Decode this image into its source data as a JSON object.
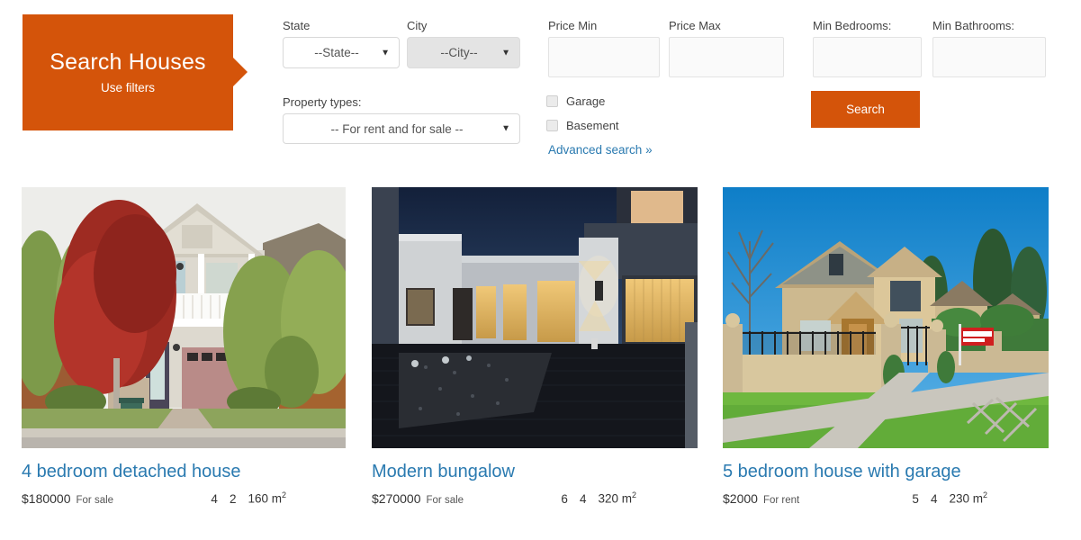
{
  "banner": {
    "title": "Search Houses",
    "subtitle": "Use filters"
  },
  "filters": {
    "state_label": "State",
    "state_value": "--State--",
    "city_label": "City",
    "city_value": "--City--",
    "property_types_label": "Property types:",
    "property_types_value": "-- For rent and for sale --",
    "price_min_label": "Price Min",
    "price_min_value": "",
    "price_max_label": "Price Max",
    "price_max_value": "",
    "min_bedrooms_label": "Min Bedrooms:",
    "min_bedrooms_value": "",
    "min_bathrooms_label": "Min Bathrooms:",
    "min_bathrooms_value": "",
    "garage_label": "Garage",
    "basement_label": "Basement",
    "advanced_search_label": "Advanced search »",
    "search_button_label": "Search",
    "accent_color": "#d4540a",
    "link_color": "#2a7ab0"
  },
  "listings": [
    {
      "title": "4 bedroom detached house",
      "price": "$180000",
      "status": "For sale",
      "bedrooms": "4",
      "bathrooms": "2",
      "area": "160 m",
      "area_exponent": "2",
      "image_alt": "two-story detached house with red maple tree and white balcony"
    },
    {
      "title": "Modern bungalow",
      "price": "$270000",
      "status": "For sale",
      "bedrooms": "6",
      "bathrooms": "4",
      "area": "320 m",
      "area_exponent": "2",
      "image_alt": "modern bungalow courtyard at dusk with lit windows"
    },
    {
      "title": "5 bedroom house with garage",
      "price": "$2000",
      "status": "For rent",
      "bedrooms": "5",
      "bathrooms": "4",
      "area": "230 m",
      "area_exponent": "2",
      "image_alt": "large suburban house with stone wall, iron fence and for sale sign"
    }
  ]
}
